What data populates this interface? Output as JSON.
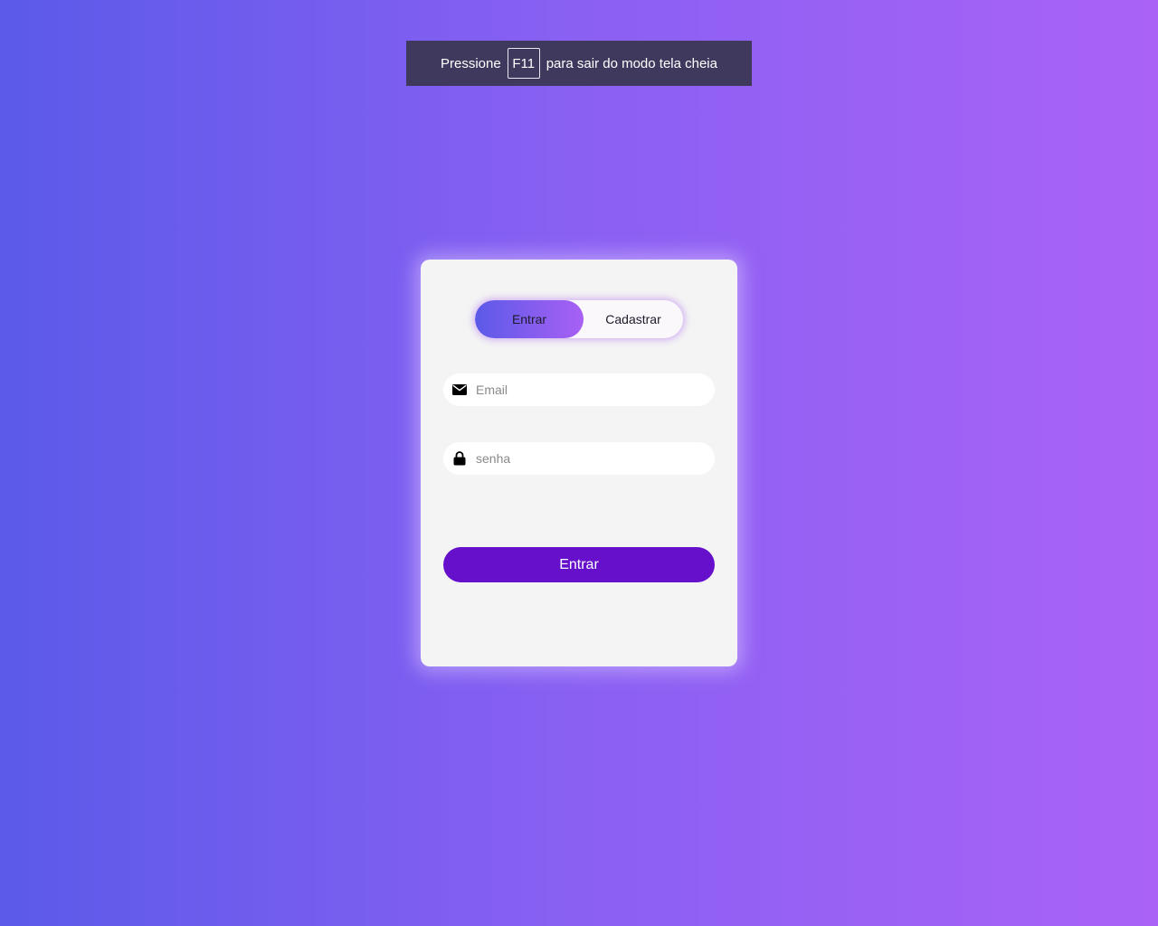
{
  "fullscreen_notice": {
    "prefix": "Pressione",
    "key": "F11",
    "suffix": "para sair do modo tela cheia"
  },
  "auth_card": {
    "toggle": {
      "login_label": "Entrar",
      "register_label": "Cadastrar",
      "active": "login"
    },
    "email_field": {
      "placeholder": "Email",
      "value": "",
      "icon": "envelope-icon"
    },
    "password_field": {
      "placeholder": "senha",
      "value": "",
      "icon": "lock-icon"
    },
    "submit_label": "Entrar"
  },
  "colors": {
    "background_start": "#5b5ae9",
    "background_end": "#aa62f6",
    "submit_button": "#6610cc",
    "card": "#f4f4f4"
  }
}
